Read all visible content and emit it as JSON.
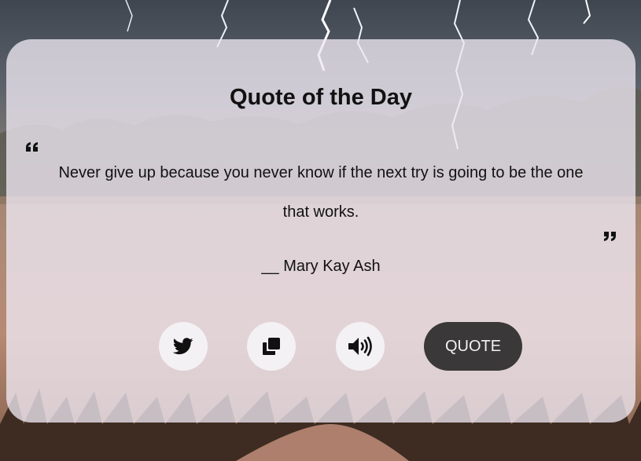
{
  "card": {
    "title": "Quote of the Day",
    "quote": "Never give up because you never know if the next try is going to be the one that works.",
    "author": "__ Mary Kay Ash"
  },
  "actions": {
    "twitter_icon": "twitter-icon",
    "copy_icon": "copy-icon",
    "speak_icon": "volume-icon",
    "quote_button_label": "QUOTE"
  },
  "colors": {
    "card_background": "#eee8f2",
    "quote_button": "#3a3838",
    "icon_button": "#f4f1f5",
    "text": "#111111"
  }
}
